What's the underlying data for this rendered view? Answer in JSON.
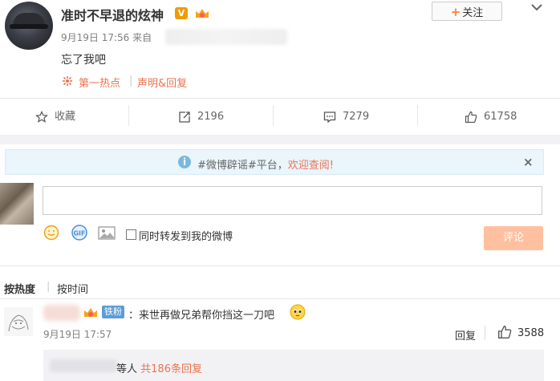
{
  "post": {
    "username": "准时不早退的炫神",
    "verified_badge": "V",
    "follow_label": "关注",
    "follow_plus": "+",
    "time_prefix": "9月19日 17:56 来自",
    "text": "忘了我吧",
    "hot_label": "第一热点",
    "separator": "|",
    "declaration_label": "声明&回复"
  },
  "actions": {
    "collect": "收藏",
    "repost": "2196",
    "comment": "7279",
    "like": "61758"
  },
  "rumor": {
    "icon": "i",
    "text": "#微博辟谣#平台，",
    "link": "欢迎查阅!",
    "close": "×"
  },
  "compose": {
    "input_value": "",
    "checkbox_label": "同时转发到我的微博",
    "submit_label": "评论"
  },
  "sort": {
    "hot": "按热度",
    "separator": "|",
    "time": "按时间"
  },
  "comment": {
    "fan_badge": "铁粉",
    "text": "：来世再做兄弟帮你挡这一刀吧",
    "time": "9月19日 17:57",
    "reply_label": "回复",
    "likes": "3588",
    "replies_suffix": "等人",
    "replies_link": "共186条回复"
  },
  "colors": {
    "accent": "#eb7350",
    "submit_disabled": "#ffc09f",
    "fan_badge": "#5c9bd6",
    "rumor_bg": "#eaf5fc"
  }
}
